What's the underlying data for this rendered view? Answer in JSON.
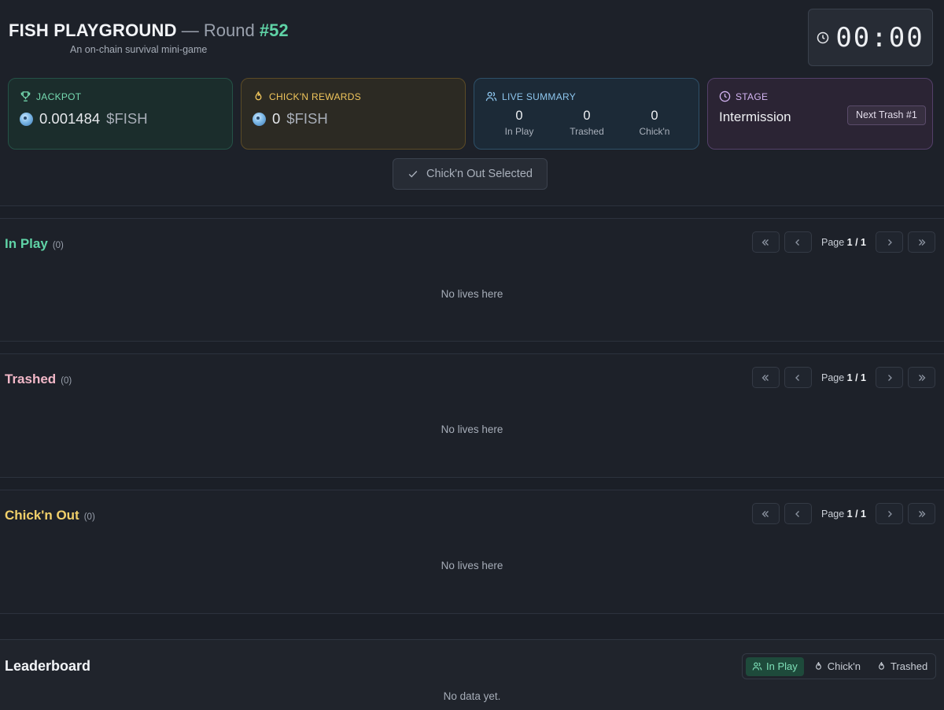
{
  "header": {
    "title": "FISH PLAYGROUND",
    "separator": "—",
    "round_label": "Round",
    "round_number": "#52",
    "subtitle": "An on-chain survival mini-game",
    "timer": "00:00"
  },
  "cards": {
    "jackpot": {
      "label": "JACKPOT",
      "amount": "0.001484",
      "unit": "$FISH",
      "icon": "trophy-icon"
    },
    "rewards": {
      "label": "CHICK'N REWARDS",
      "amount": "0",
      "unit": "$FISH",
      "icon": "flame-icon"
    },
    "live": {
      "label": "LIVE SUMMARY",
      "icon": "users-icon",
      "stats": [
        {
          "value": "0",
          "label": "In Play"
        },
        {
          "value": "0",
          "label": "Trashed"
        },
        {
          "value": "0",
          "label": "Chick'n"
        }
      ]
    },
    "stage": {
      "label": "STAGE",
      "value": "Intermission",
      "badge": "Next Trash #1",
      "icon": "clock-icon"
    }
  },
  "actions": {
    "chickn_out": "Chick'n Out Selected"
  },
  "sections": [
    {
      "title": "In Play",
      "count": "(0)",
      "page_label": "Page",
      "page": "1 / 1",
      "empty": "No lives here",
      "color": "#5fd3a6"
    },
    {
      "title": "Trashed",
      "count": "(0)",
      "page_label": "Page",
      "page": "1 / 1",
      "empty": "No lives here",
      "color": "#f2b8c8"
    },
    {
      "title": "Chick'n Out",
      "count": "(0)",
      "page_label": "Page",
      "page": "1 / 1",
      "empty": "No lives here",
      "color": "#f1d06a"
    }
  ],
  "leaderboard": {
    "title": "Leaderboard",
    "tabs": [
      {
        "label": "In Play",
        "icon": "users-icon",
        "active": true
      },
      {
        "label": "Chick'n",
        "icon": "flame-icon",
        "active": false
      },
      {
        "label": "Trashed",
        "icon": "flame-icon",
        "active": false
      }
    ],
    "empty": "No data yet."
  },
  "colors": {
    "background": "#1b1f27",
    "accent_green": "#5fd3a6",
    "accent_gold": "#f1c65c",
    "accent_blue": "#8dc6ee",
    "accent_purple": "#d3b4f2"
  }
}
